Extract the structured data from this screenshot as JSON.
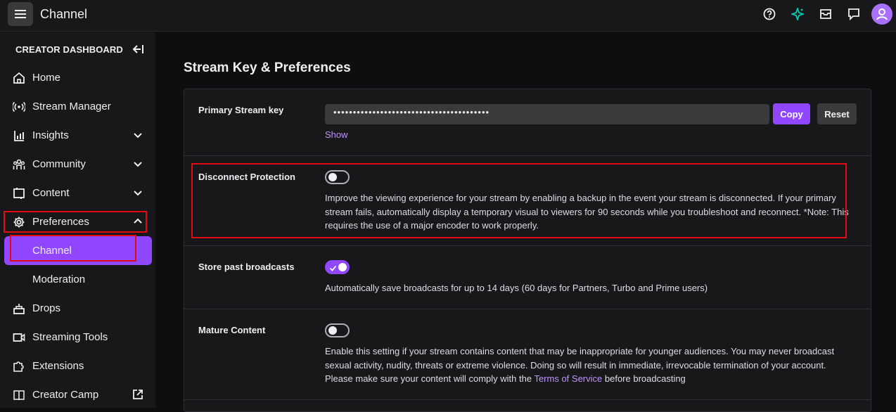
{
  "topbar": {
    "title": "Channel",
    "icons": [
      "menu-icon",
      "help-icon",
      "sparkle-icon",
      "inbox-icon",
      "whispers-icon",
      "avatar-icon"
    ]
  },
  "sidebar": {
    "header": "CREATOR DASHBOARD",
    "items": [
      {
        "label": "Home",
        "icon": "home-icon"
      },
      {
        "label": "Stream Manager",
        "icon": "broadcast-icon"
      },
      {
        "label": "Insights",
        "icon": "insights-icon"
      },
      {
        "label": "Community",
        "icon": "community-icon"
      },
      {
        "label": "Content",
        "icon": "content-icon"
      },
      {
        "label": "Preferences",
        "icon": "gear-icon"
      },
      {
        "label": "Channel"
      },
      {
        "label": "Moderation"
      },
      {
        "label": "Drops",
        "icon": "drops-icon"
      },
      {
        "label": "Streaming Tools",
        "icon": "camera-icon"
      },
      {
        "label": "Extensions",
        "icon": "puzzle-icon"
      },
      {
        "label": "Creator Camp",
        "icon": "book-icon"
      }
    ]
  },
  "main": {
    "title": "Stream Key & Preferences",
    "stream_key": {
      "label": "Primary Stream key",
      "value": "••••••••••••••••••••••••••••••••••••••••",
      "copy_label": "Copy",
      "reset_label": "Reset",
      "show_label": "Show"
    },
    "disconnect": {
      "label": "Disconnect Protection",
      "enabled": false,
      "description": "Improve the viewing experience for your stream by enabling a backup in the event your stream is disconnected. If your primary stream fails, automatically display a temporary visual to viewers for 90 seconds while you troubleshoot and reconnect. *Note: This requires the use of a major encoder to work properly."
    },
    "past_broadcasts": {
      "label": "Store past broadcasts",
      "enabled": true,
      "description": "Automatically save broadcasts for up to 14 days (60 days for Partners, Turbo and Prime users)"
    },
    "mature": {
      "label": "Mature Content",
      "enabled": false,
      "description_before": "Enable this setting if your stream contains content that may be inappropriate for younger audiences. You may never broadcast sexual activity, nudity, threats or extreme violence. Doing so will result in immediate, irrevocable termination of your account. Please make sure your content will comply with the ",
      "link_text": "Terms of Service",
      "description_after": " before broadcasting"
    }
  },
  "colors": {
    "accent": "#9147ff",
    "link": "#bf94ff",
    "highlight": "#e00b14"
  }
}
